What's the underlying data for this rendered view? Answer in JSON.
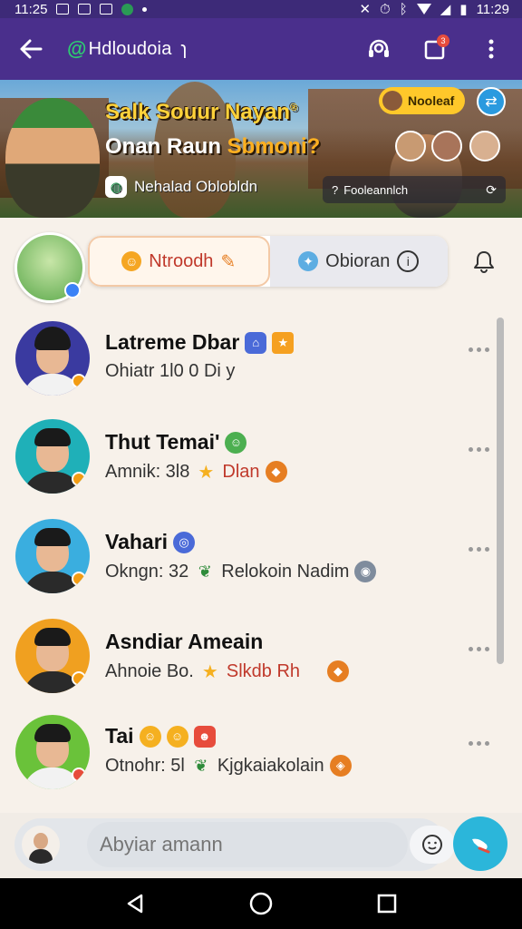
{
  "status_bar": {
    "time_left": "11:25",
    "time_right": "11:29"
  },
  "app_bar": {
    "title": "Hdloudoia",
    "title_suffix": "ɿ",
    "logo_glyph": "@",
    "notif_count": "3"
  },
  "banner": {
    "title": "Salk Souur Nayan",
    "title_mark": "®",
    "subtitle_prefix": "Onan Raun ",
    "subtitle_highlight": "Sbmoni?",
    "meta_label": "Nehalad Oblobldn",
    "pill_label": "Nooleaf",
    "chip_label": "Fooleannlch",
    "chip_prefix": "?"
  },
  "filters": {
    "tabs": [
      {
        "label": "Ntroodh",
        "active": true
      },
      {
        "label": "Obioran",
        "active": false
      }
    ]
  },
  "list": {
    "items": [
      {
        "name": "Latreme Dbar",
        "name_emojis": [
          "🏠",
          "⭐"
        ],
        "sub": "Ohiatr 1l0 0 Di y",
        "sub_extra": "",
        "sub_emoji": "",
        "avatar_bg": "#3a3aa0",
        "badge_color": "#f39c12"
      },
      {
        "name": "Thut Temai'",
        "name_emojis": [
          "😺"
        ],
        "sub": "Amnik: 3l8 ",
        "sub_extra": "Dlan",
        "sub_emoji": "⭐",
        "avatar_bg": "#1fb0b8",
        "badge_color": "#f39c12"
      },
      {
        "name": "Vahari",
        "name_emojis": [
          "🌀"
        ],
        "sub": "Okngn: 32 ",
        "sub_extra": "Relokoin Nadim",
        "sub_emoji": "🌿",
        "avatar_bg": "#3aaedf",
        "badge_color": "#f39c12"
      },
      {
        "name": "Asndiar Ameain",
        "name_emojis": [],
        "sub": "Ahnoie Bo. ",
        "sub_extra": "Slkdb Rh",
        "sub_emoji": "⭐",
        "avatar_bg": "#f0a020",
        "badge_color": "#f39c12"
      },
      {
        "name": "Tai",
        "name_emojis": [
          "😊",
          "😊",
          "😺"
        ],
        "sub": "Otnohr: 5l ",
        "sub_extra": "Kjgkaiakolain",
        "sub_emoji": "🌿",
        "avatar_bg": "#6ac23a",
        "badge_color": "#e74c3c"
      }
    ]
  },
  "composer": {
    "placeholder": "Abyiar amann"
  },
  "colors": {
    "primary": "#4a2f8c",
    "accent": "#2bb6da",
    "active_tab": "#c0392b"
  },
  "icons": [
    "back-arrow-icon",
    "headset-icon",
    "square-icon",
    "more-vert-icon",
    "bell-icon",
    "emoji-icon",
    "send-icon",
    "back-triangle-icon",
    "home-circle-icon",
    "recents-square-icon"
  ]
}
